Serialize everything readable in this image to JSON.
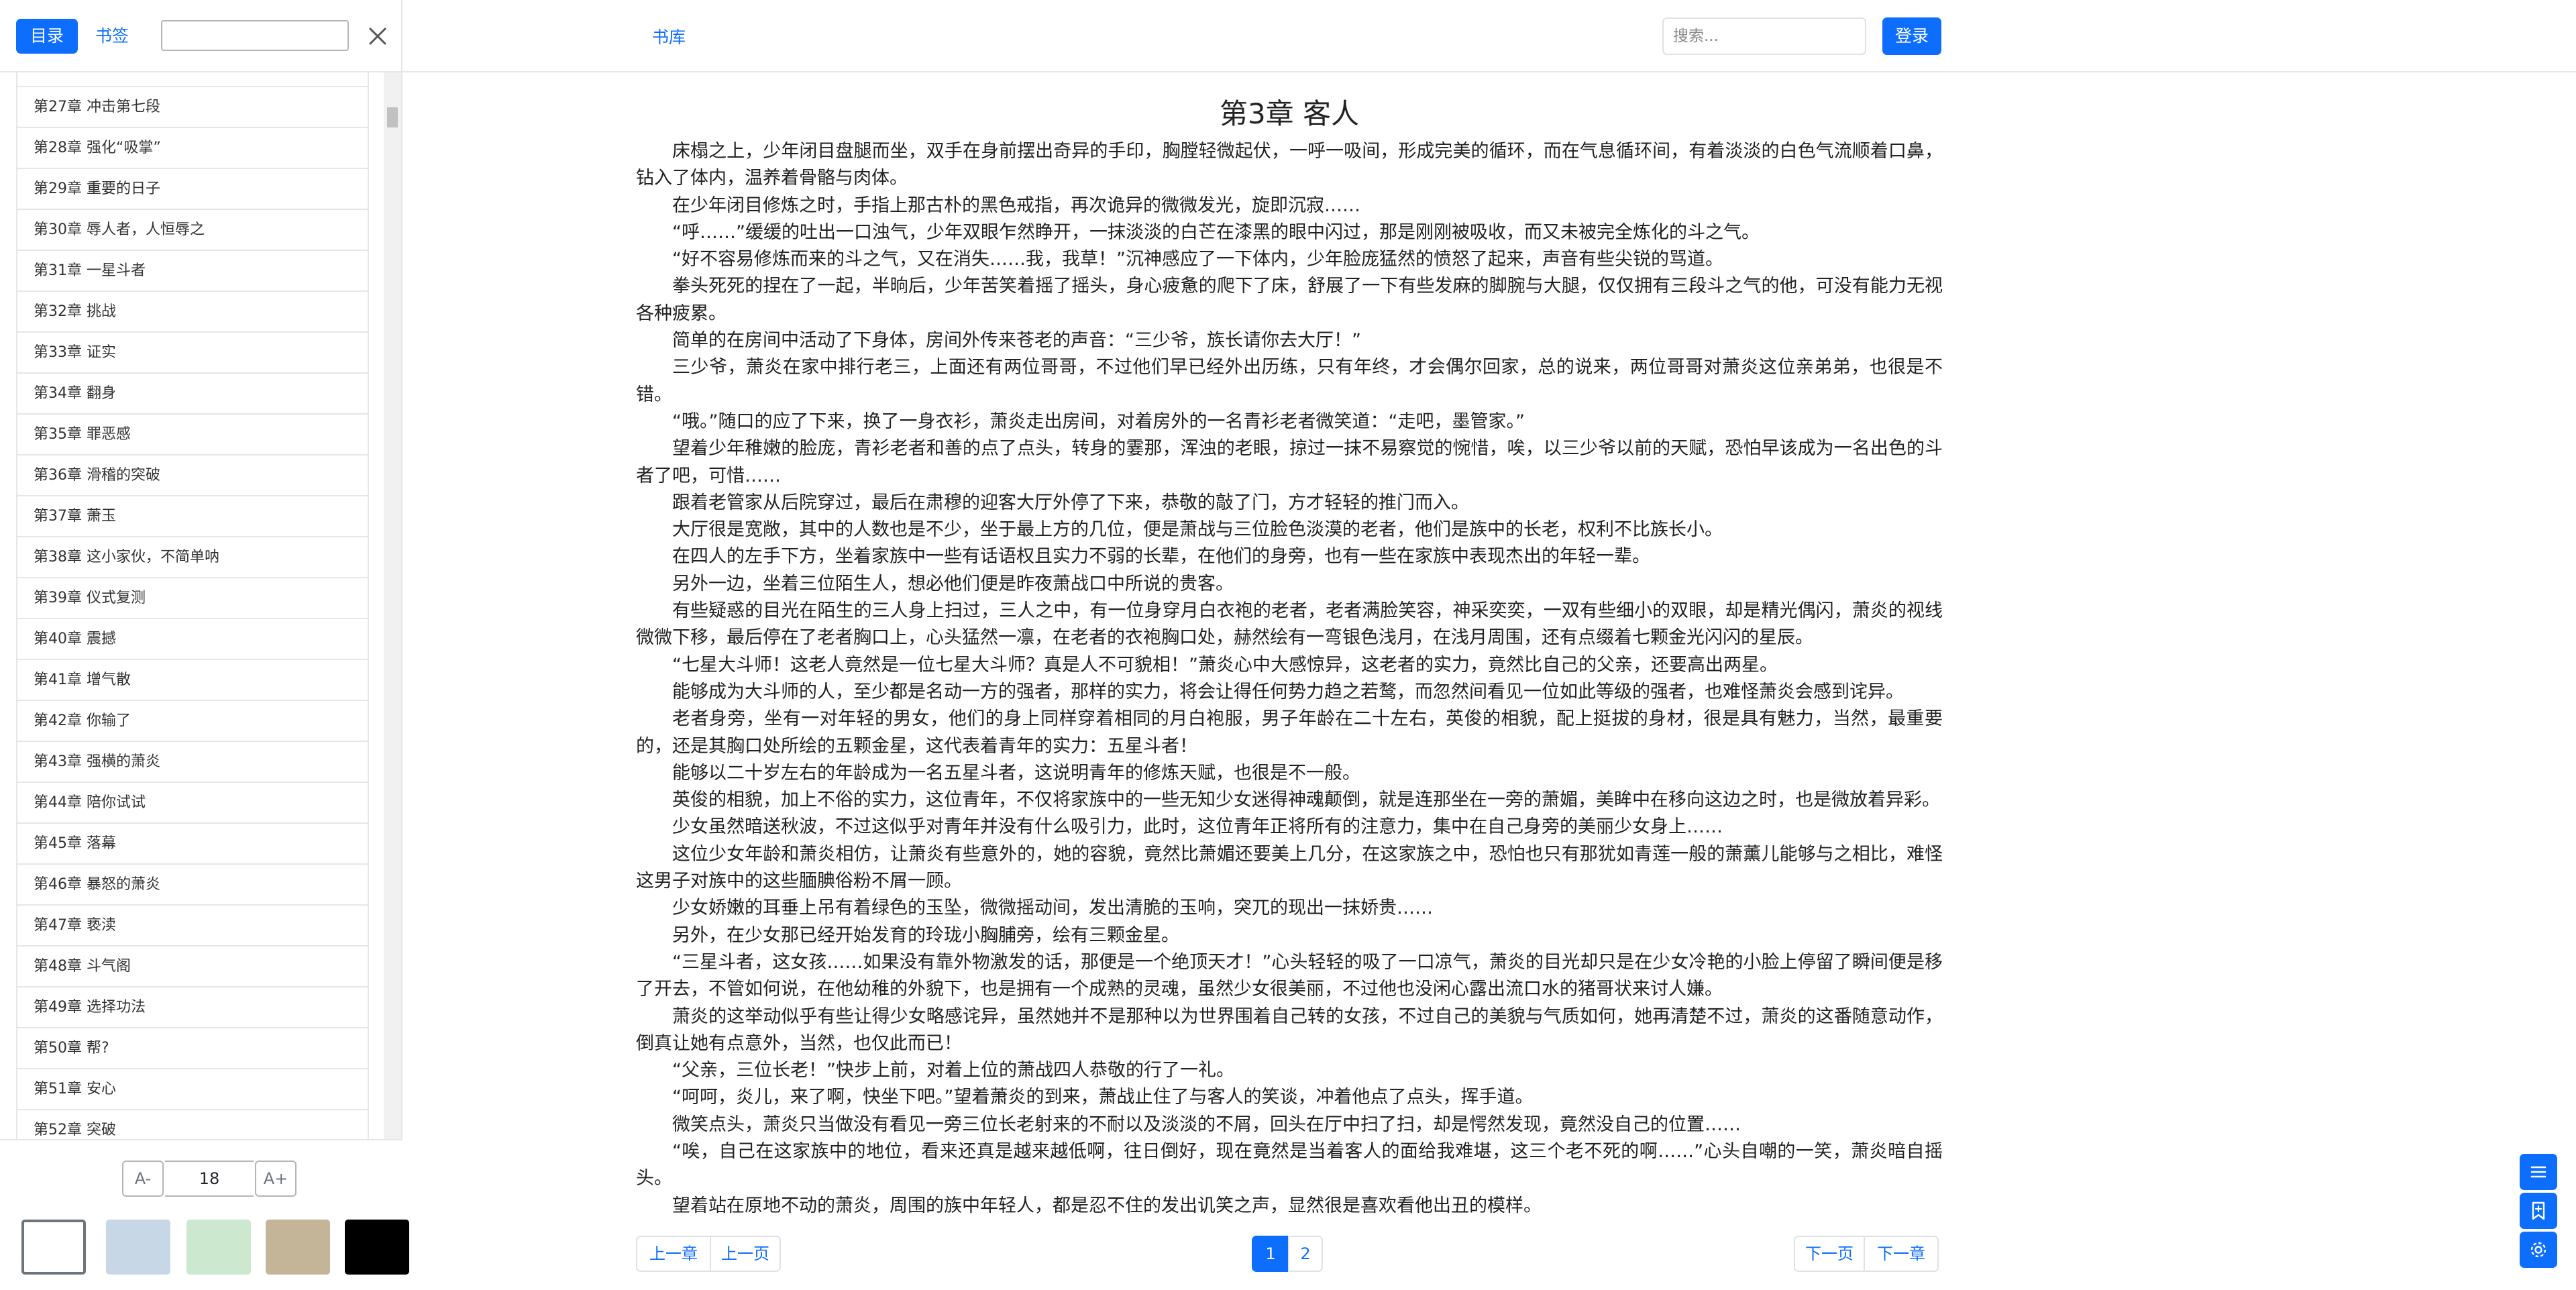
{
  "sidebar": {
    "tab_toc": "目录",
    "tab_bookmark": "书签",
    "chapters": [
      "第27章 冲击第七段",
      "第28章 强化“吸掌”",
      "第29章 重要的日子",
      "第30章 辱人者，人恒辱之",
      "第31章 一星斗者",
      "第32章 挑战",
      "第33章 证实",
      "第34章 翻身",
      "第35章 罪恶感",
      "第36章 滑稽的突破",
      "第37章 萧玉",
      "第38章 这小家伙，不简单呐",
      "第39章 仪式复测",
      "第40章 震撼",
      "第41章 增气散",
      "第42章 你输了",
      "第43章 强横的萧炎",
      "第44章 陪你试试",
      "第45章 落幕",
      "第46章 暴怒的萧炎",
      "第47章 亵渎",
      "第48章 斗气阁",
      "第49章 选择功法",
      "第50章 帮?",
      "第51章 安心",
      "第52章 突破"
    ],
    "font": {
      "dec_label": "A-",
      "size": "18",
      "inc_label": "A+"
    },
    "themes": [
      {
        "name": "white",
        "color": "#ffffff"
      },
      {
        "name": "blue",
        "color": "#c7d7e6"
      },
      {
        "name": "green",
        "color": "#cce8cf"
      },
      {
        "name": "tan",
        "color": "#c5b598"
      },
      {
        "name": "black",
        "color": "#000000"
      }
    ]
  },
  "navbar": {
    "library_label": "书库",
    "search_placeholder": "搜索...",
    "login_label": "登录"
  },
  "content": {
    "title": "第3章 客人",
    "paragraphs": [
      "床榻之上，少年闭目盘腿而坐，双手在身前摆出奇异的手印，胸膛轻微起伏，一呼一吸间，形成完美的循环，而在气息循环间，有着淡淡的白色气流顺着口鼻，钻入了体内，温养着骨骼与肉体。",
      "在少年闭目修炼之时，手指上那古朴的黑色戒指，再次诡异的微微发光，旋即沉寂……",
      "“呼……”缓缓的吐出一口浊气，少年双眼乍然睁开，一抹淡淡的白芒在漆黑的眼中闪过，那是刚刚被吸收，而又未被完全炼化的斗之气。",
      "“好不容易修炼而来的斗之气，又在消失……我，我草！”沉神感应了一下体内，少年脸庞猛然的愤怒了起来，声音有些尖锐的骂道。",
      "拳头死死的捏在了一起，半晌后，少年苦笑着摇了摇头，身心疲惫的爬下了床，舒展了一下有些发麻的脚腕与大腿，仅仅拥有三段斗之气的他，可没有能力无视各种疲累。",
      "简单的在房间中活动了下身体，房间外传来苍老的声音：“三少爷，族长请你去大厅！”",
      "三少爷，萧炎在家中排行老三，上面还有两位哥哥，不过他们早已经外出历练，只有年终，才会偶尔回家，总的说来，两位哥哥对萧炎这位亲弟弟，也很是不错。",
      "“哦。”随口的应了下来，换了一身衣衫，萧炎走出房间，对着房外的一名青衫老者微笑道：“走吧，墨管家。”",
      "望着少年稚嫩的脸庞，青衫老者和善的点了点头，转身的霎那，浑浊的老眼，掠过一抹不易察觉的惋惜，唉，以三少爷以前的天赋，恐怕早该成为一名出色的斗者了吧，可惜……",
      "跟着老管家从后院穿过，最后在肃穆的迎客大厅外停了下来，恭敬的敲了门，方才轻轻的推门而入。",
      "大厅很是宽敞，其中的人数也是不少，坐于最上方的几位，便是萧战与三位脸色淡漠的老者，他们是族中的长老，权利不比族长小。",
      "在四人的左手下方，坐着家族中一些有话语权且实力不弱的长辈，在他们的身旁，也有一些在家族中表现杰出的年轻一辈。",
      "另外一边，坐着三位陌生人，想必他们便是昨夜萧战口中所说的贵客。",
      "有些疑惑的目光在陌生的三人身上扫过，三人之中，有一位身穿月白衣袍的老者，老者满脸笑容，神采奕奕，一双有些细小的双眼，却是精光偶闪，萧炎的视线微微下移，最后停在了老者胸口上，心头猛然一凛，在老者的衣袍胸口处，赫然绘有一弯银色浅月，在浅月周围，还有点缀着七颗金光闪闪的星辰。",
      "“七星大斗师！这老人竟然是一位七星大斗师？真是人不可貌相！”萧炎心中大感惊异，这老者的实力，竟然比自己的父亲，还要高出两星。",
      "能够成为大斗师的人，至少都是名动一方的强者，那样的实力，将会让得任何势力趋之若鹜，而忽然间看见一位如此等级的强者，也难怪萧炎会感到诧异。",
      "老者身旁，坐有一对年轻的男女，他们的身上同样穿着相同的月白袍服，男子年龄在二十左右，英俊的相貌，配上挺拔的身材，很是具有魅力，当然，最重要的，还是其胸口处所绘的五颗金星，这代表着青年的实力：五星斗者！",
      "能够以二十岁左右的年龄成为一名五星斗者，这说明青年的修炼天赋，也很是不一般。",
      "英俊的相貌，加上不俗的实力，这位青年，不仅将家族中的一些无知少女迷得神魂颠倒，就是连那坐在一旁的萧媚，美眸中在移向这边之时，也是微放着异彩。",
      "少女虽然暗送秋波，不过这似乎对青年并没有什么吸引力，此时，这位青年正将所有的注意力，集中在自己身旁的美丽少女身上……",
      "这位少女年龄和萧炎相仿，让萧炎有些意外的，她的容貌，竟然比萧媚还要美上几分，在这家族之中，恐怕也只有那犹如青莲一般的萧薰儿能够与之相比，难怪这男子对族中的这些腼腆俗粉不屑一顾。",
      "少女娇嫩的耳垂上吊有着绿色的玉坠，微微摇动间，发出清脆的玉响，突兀的现出一抹娇贵……",
      "另外，在少女那已经开始发育的玲珑小胸脯旁，绘有三颗金星。",
      "“三星斗者，这女孩……如果没有靠外物激发的话，那便是一个绝顶天才！”心头轻轻的吸了一口凉气，萧炎的目光却只是在少女冷艳的小脸上停留了瞬间便是移了开去，不管如何说，在他幼稚的外貌下，也是拥有一个成熟的灵魂，虽然少女很美丽，不过他也没闲心露出流口水的猪哥状来讨人嫌。",
      "萧炎的这举动似乎有些让得少女略感诧异，虽然她并不是那种以为世界围着自己转的女孩，不过自己的美貌与气质如何，她再清楚不过，萧炎的这番随意动作，倒真让她有点意外，当然，也仅此而已！",
      "“父亲，三位长老！”快步上前，对着上位的萧战四人恭敬的行了一礼。",
      "“呵呵，炎儿，来了啊，快坐下吧。”望着萧炎的到来，萧战止住了与客人的笑谈，冲着他点了点头，挥手道。",
      "微笑点头，萧炎只当做没有看见一旁三位长老射来的不耐以及淡淡的不屑，回头在厅中扫了扫，却是愕然发现，竟然没自己的位置……",
      "“唉，自己在这家族中的地位，看来还真是越来越低啊，往日倒好，现在竟然是当着客人的面给我难堪，这三个老不死的啊……”心头自嘲的一笑，萧炎暗自摇头。",
      "望着站在原地不动的萧炎，周围的族中年轻人，都是忍不住的发出讥笑之声，显然很是喜欢看他出丑的模样。"
    ]
  },
  "pagination": {
    "prev_chapter": "上一章",
    "prev_page": "上一页",
    "pages": [
      "1",
      "2"
    ],
    "current_page": "1",
    "next_page": "下一页",
    "next_chapter": "下一章"
  },
  "floating_tools": [
    "list-icon",
    "bookmark-icon",
    "gear-icon"
  ]
}
